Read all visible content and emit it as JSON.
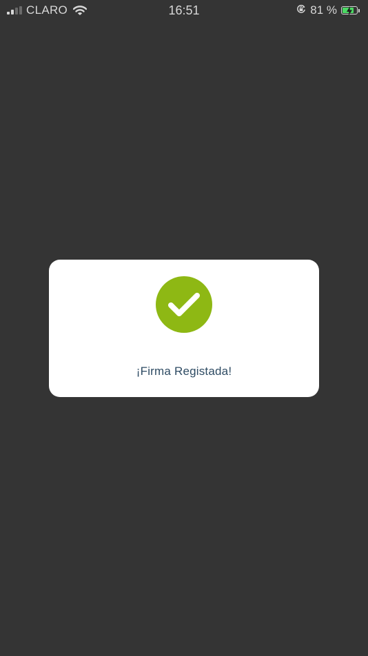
{
  "status_bar": {
    "carrier": "CLARO",
    "time": "16:51",
    "battery_percent": "81 %",
    "battery_level": 0.81,
    "icons": [
      "signal-icon",
      "wifi-icon",
      "orientation-lock-icon",
      "battery-charging-icon"
    ]
  },
  "modal": {
    "icon": "check-circle-icon",
    "icon_color": "#8eb814",
    "message": "¡Firma Registada!"
  },
  "colors": {
    "overlay_background": "#343434",
    "modal_background": "#ffffff",
    "message_text": "#2e4b63"
  }
}
